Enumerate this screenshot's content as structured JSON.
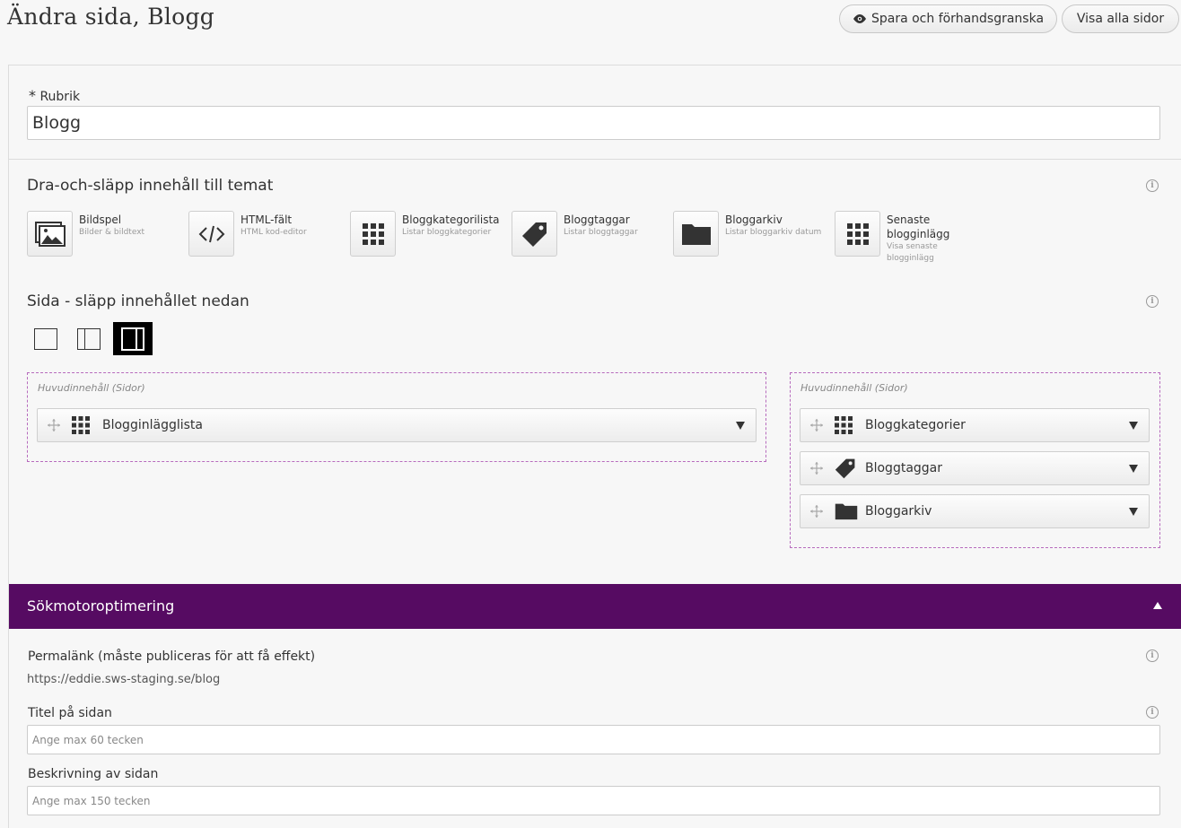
{
  "header": {
    "title": "Ändra sida, Blogg",
    "preview_button": "Spara och förhandsgranska",
    "view_all_button": "Visa alla sidor"
  },
  "rubrik": {
    "required_marker": "*",
    "label": "Rubrik",
    "value": "Blogg"
  },
  "widgets_section": {
    "title": "Dra-och-släpp innehåll till temat",
    "items": [
      {
        "name": "Bildspel",
        "desc": "Bilder & bildtext",
        "icon": "image-icon"
      },
      {
        "name": "HTML-fält",
        "desc": "HTML kod-editor",
        "icon": "code-icon"
      },
      {
        "name": "Bloggkategorilista",
        "desc": "Listar bloggkategorier",
        "icon": "grid-icon"
      },
      {
        "name": "Bloggtaggar",
        "desc": "Listar bloggtaggar",
        "icon": "tag-icon"
      },
      {
        "name": "Bloggarkiv",
        "desc": "Listar bloggarkiv datum",
        "icon": "folder-icon"
      },
      {
        "name": "Senaste blogginlägg",
        "desc": "Visa senaste blogginlägg",
        "icon": "grid-icon"
      }
    ]
  },
  "page_section": {
    "title": "Sida - släpp innehållet nedan",
    "layouts": [
      "single-column",
      "two-column-narrow",
      "two-column-wide"
    ],
    "active_layout": "two-column-wide",
    "left_zone": {
      "label": "Huvudinnehåll (Sidor)",
      "items": [
        {
          "label": "Blogginlägglista",
          "icon": "grid-icon"
        }
      ]
    },
    "right_zone": {
      "label": "Huvudinnehåll (Sidor)",
      "items": [
        {
          "label": "Bloggkategorier",
          "icon": "grid-icon"
        },
        {
          "label": "Bloggtaggar",
          "icon": "tag-icon"
        },
        {
          "label": "Bloggarkiv",
          "icon": "folder-icon"
        }
      ]
    }
  },
  "seo": {
    "title": "Sökmotoroptimering",
    "permalink_label": "Permalänk (måste publiceras för att få effekt)",
    "permalink_value": "https://eddie.sws-staging.se/blog",
    "page_title_label": "Titel på sidan",
    "page_title_placeholder": "Ange max 60 tecken",
    "description_label": "Beskrivning av sidan",
    "description_placeholder": "Ange max 150 tecken"
  },
  "colors": {
    "seo_bar": "#560b62",
    "dropzone_border": "#b76bbd"
  }
}
